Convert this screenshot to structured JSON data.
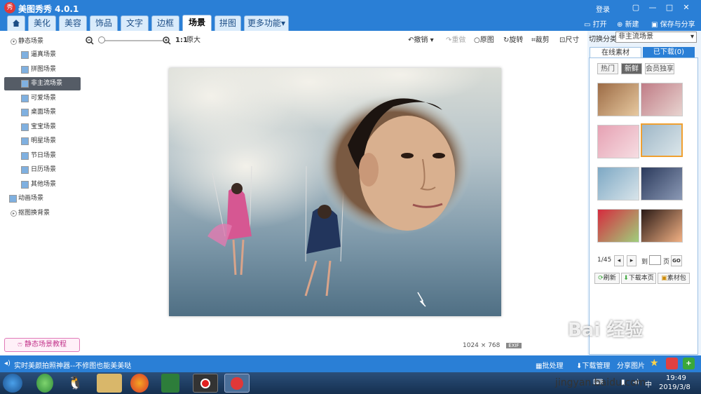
{
  "app": {
    "logo_text": "秀",
    "title": "美图秀秀 4.0.1",
    "login": "登录"
  },
  "window_controls": {
    "restore": "▢",
    "minimize": "—",
    "maximize": "□",
    "close": "✕"
  },
  "tabs": {
    "home_icon": "home-icon",
    "items": [
      "美化",
      "美容",
      "饰品",
      "文字",
      "边框",
      "场景",
      "拼图",
      "更多功能"
    ],
    "active": "场景"
  },
  "top_right": {
    "open": "打开",
    "new": "新建",
    "save_share": "保存与分享"
  },
  "sidebar": {
    "static_group": "静态场景",
    "items": [
      "逼真场景",
      "拼图场景",
      "非主流场景",
      "可爱场景",
      "桌面场景",
      "宝宝场景",
      "明星场景",
      "节日场景",
      "日历场景",
      "其他场景"
    ],
    "selected": "非主流场景",
    "animated": "动画场景",
    "cutout_bg": "抠图换背景",
    "tutorial": "静态场景教程"
  },
  "toolbar": {
    "ratio": "1:1",
    "original_size": "原大",
    "undo": "撤销",
    "redo": "重做",
    "original": "原图",
    "rotate": "旋转",
    "crop": "裁剪",
    "resize": "尺寸"
  },
  "image": {
    "width": "1024",
    "times": "×",
    "height": "768",
    "exif": "EXIF"
  },
  "right_panel": {
    "category_label": "切换分类",
    "category_value": "非主流场景",
    "tab_online": "在线素材",
    "tab_downloaded": "已下载(0)",
    "subtabs": [
      "热门",
      "新鲜",
      "会员独享"
    ],
    "active_subtab": "新鲜",
    "page": "1/45",
    "goto_label": "到",
    "page_label": "页",
    "go_button": "GO",
    "refresh": "刷新",
    "download_page": "下载本页",
    "material_pack": "素材包"
  },
  "statusbar": {
    "message": "实时美颜拍照神器--不修图也能美美哒",
    "batch": "批处理",
    "download_mgr": "下载管理",
    "share_pic": "分享图片"
  },
  "taskbar": {
    "time": "19:49",
    "date": "2019/3/8"
  },
  "watermark": {
    "text": "Bai 经验",
    "url": "jingyan.baidu.com"
  },
  "colors": {
    "brand_blue": "#2a7fd6",
    "selected_item": "#555c66",
    "tutorial_pink": "#c2338a"
  }
}
